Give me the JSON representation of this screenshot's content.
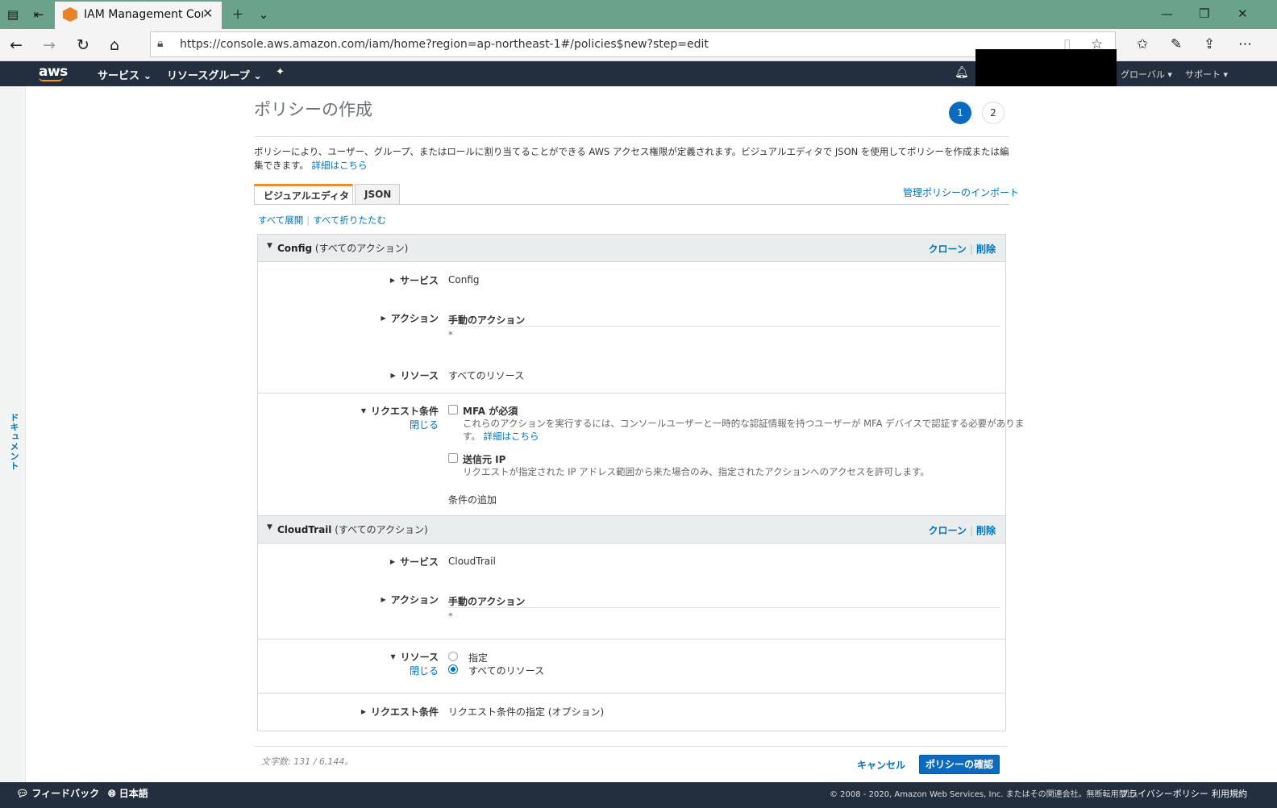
{
  "browser": {
    "tab_title": "IAM Management Cons",
    "url": "https://console.aws.amazon.com/iam/home?region=ap-northeast-1#/policies$new?step=edit"
  },
  "aws_nav": {
    "logo": "aws",
    "services": "サービス",
    "resource_groups": "リソースグループ",
    "global": "グローバル",
    "support": "サポート"
  },
  "docs_label": "ドキュメント",
  "page": {
    "title": "ポリシーの作成",
    "steps": [
      "1",
      "2"
    ],
    "intro": "ポリシーにより、ユーザー、グループ、またはロールに割り当てることができる AWS アクセス権限が定義されます。ビジュアルエディタで JSON を使用してポリシーを作成または編集できます。",
    "learn_more": "詳細はこちら",
    "tabs": [
      "ビジュアルエディタ",
      "JSON"
    ],
    "import_link": "管理ポリシーのインポート",
    "expand_all": "すべて展開",
    "collapse_all": "すべて折りたたむ"
  },
  "blocks": {
    "config": {
      "name": "Config",
      "suffix": "(すべてのアクション)",
      "clone": "クローン",
      "delete": "削除",
      "service_label": "サービス",
      "service_value": "Config",
      "action_label": "アクション",
      "action_value": "手動のアクション",
      "action_star": "*",
      "resource_label": "リソース",
      "resource_value": "すべてのリソース",
      "request_label": "リクエスト条件",
      "close": "閉じる",
      "mfa_label": "MFA が必須",
      "mfa_desc_1": "これらのアクションを実行するには、コンソールユーザーと一時的な認証情報を持つユーザーが MFA デバイスで認証する必要がありま",
      "mfa_desc_2": "す。",
      "mfa_learn": "詳細はこちら",
      "ip_label": "送信元 IP",
      "ip_desc": "リクエストが指定された IP アドレス範囲から来た場合のみ、指定されたアクションへのアクセスを許可します。",
      "add_condition": "条件の追加"
    },
    "cloudtrail": {
      "name": "CloudTrail",
      "suffix": "(すべてのアクション)",
      "clone": "クローン",
      "delete": "削除",
      "service_label": "サービス",
      "service_value": "CloudTrail",
      "action_label": "アクション",
      "action_value": "手動のアクション",
      "action_star": "*",
      "resource_label": "リソース",
      "close": "閉じる",
      "radio_specific": "指定",
      "radio_all": "すべてのリソース",
      "request_label": "リクエスト条件",
      "request_link": "リクエスト条件の指定 (オプション)"
    }
  },
  "footer": {
    "char_count": "文字数: 131 / 6,144。",
    "cancel": "キャンセル",
    "review": "ポリシーの確認"
  },
  "bottom": {
    "feedback": "フィードバック",
    "language": "日本語",
    "copyright": "© 2008 - 2020, Amazon Web Services, Inc. またはその関連会社。無断転用禁止。",
    "privacy": "プライバシーポリシー",
    "terms": "利用規約"
  }
}
